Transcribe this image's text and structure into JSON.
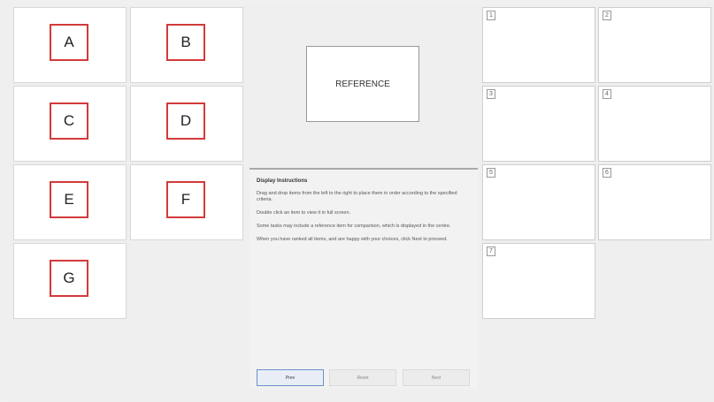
{
  "items": [
    {
      "label": "A"
    },
    {
      "label": "B"
    },
    {
      "label": "C"
    },
    {
      "label": "D"
    },
    {
      "label": "E"
    },
    {
      "label": "F"
    },
    {
      "label": "G"
    }
  ],
  "reference": {
    "label": "REFERENCE"
  },
  "slots": [
    {
      "num": "1"
    },
    {
      "num": "2"
    },
    {
      "num": "3"
    },
    {
      "num": "4"
    },
    {
      "num": "5"
    },
    {
      "num": "6"
    },
    {
      "num": "7"
    }
  ],
  "instructions": {
    "title": "Display Instructions",
    "paragraphs": [
      "Drag and drop items from the left to the right to place them in order according to the specified criteria.",
      "Double click an item to view it in full screen.",
      "Some tasks may include a reference item for comparison, which is displayed in the centre.",
      "When you have ranked all items, and are happy with your choices, click Next to proceed."
    ]
  },
  "buttons": {
    "prev": "Prev",
    "reset": "Reset",
    "next": "Next"
  },
  "colors": {
    "item_border": "#d33a3a",
    "primary_button_border": "#6a8fc9"
  }
}
